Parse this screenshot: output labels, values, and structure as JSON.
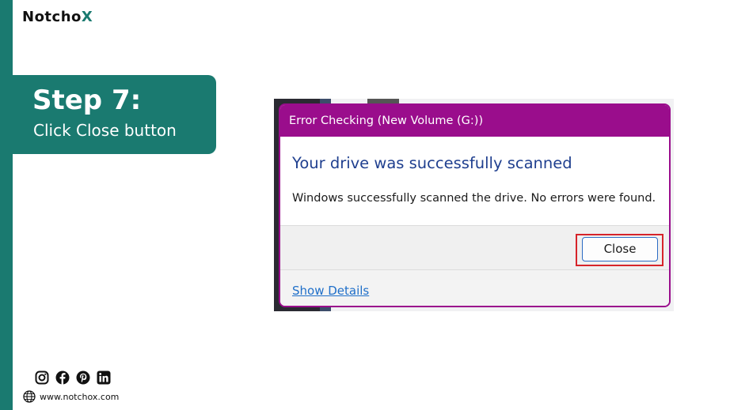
{
  "brand": {
    "name_prefix": "Notch",
    "name_o": "o",
    "name_x": "X"
  },
  "step": {
    "title": "Step 7:",
    "subtitle": "Click Close button"
  },
  "dialog": {
    "title": "Error Checking (New Volume (G:))",
    "heading": "Your drive was successfully scanned",
    "message": "Windows successfully scanned the drive. No errors were found.",
    "close_label": "Close",
    "details_link": "Show Details"
  },
  "social": {
    "icons": [
      "instagram-icon",
      "facebook-icon",
      "pinterest-icon",
      "linkedin-icon"
    ]
  },
  "website": {
    "url": "www.notchox.com"
  },
  "colors": {
    "brand": "#1a7a70",
    "titlebar": "#9a0d8c",
    "highlight": "#d6242a",
    "heading": "#1f3f8f"
  }
}
